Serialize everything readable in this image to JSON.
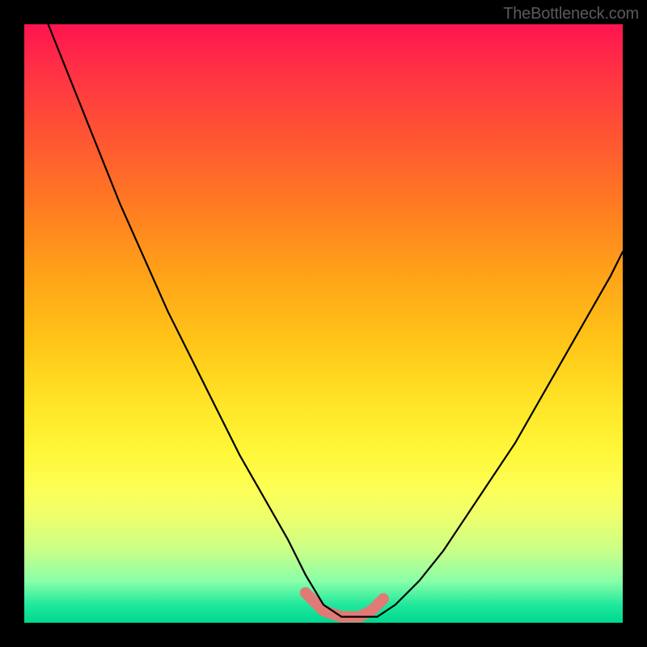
{
  "watermark": {
    "text": "TheBottleneck.com"
  },
  "colors": {
    "frame": "#000000",
    "curve": "#000000",
    "valley_marker": "#e07a76",
    "gradient_stops": [
      "#ff1450",
      "#ff3244",
      "#ff5234",
      "#ff7a22",
      "#ffa318",
      "#ffc818",
      "#ffe628",
      "#fff83a",
      "#fcff58",
      "#eaff70",
      "#c8ff88",
      "#8affa8",
      "#20e89c",
      "#00d890"
    ]
  },
  "chart_data": {
    "type": "line",
    "title": "",
    "xlabel": "",
    "ylabel": "",
    "xlim": [
      0,
      100
    ],
    "ylim": [
      0,
      100
    ],
    "grid": false,
    "legend": false,
    "note": "y = 0 at bottom, x = 0 at left. Curve is a bottleneck V with flat valley floor at y≈1–2.",
    "series": [
      {
        "name": "bottleneck-curve",
        "x": [
          4,
          8,
          12,
          16,
          20,
          24,
          28,
          32,
          36,
          40,
          44,
          47,
          50,
          53,
          56,
          59,
          62,
          66,
          70,
          74,
          78,
          82,
          86,
          90,
          94,
          98,
          100
        ],
        "y": [
          100,
          90,
          80,
          70,
          61,
          52,
          44,
          36,
          28,
          21,
          14,
          8,
          3,
          1,
          1,
          1,
          3,
          7,
          12,
          18,
          24,
          30,
          37,
          44,
          51,
          58,
          62
        ]
      }
    ],
    "valley_marker": {
      "name": "highlighted-valley",
      "x": [
        47,
        50,
        53,
        56,
        58,
        60
      ],
      "y": [
        5,
        2,
        1,
        1,
        2,
        4
      ]
    }
  }
}
